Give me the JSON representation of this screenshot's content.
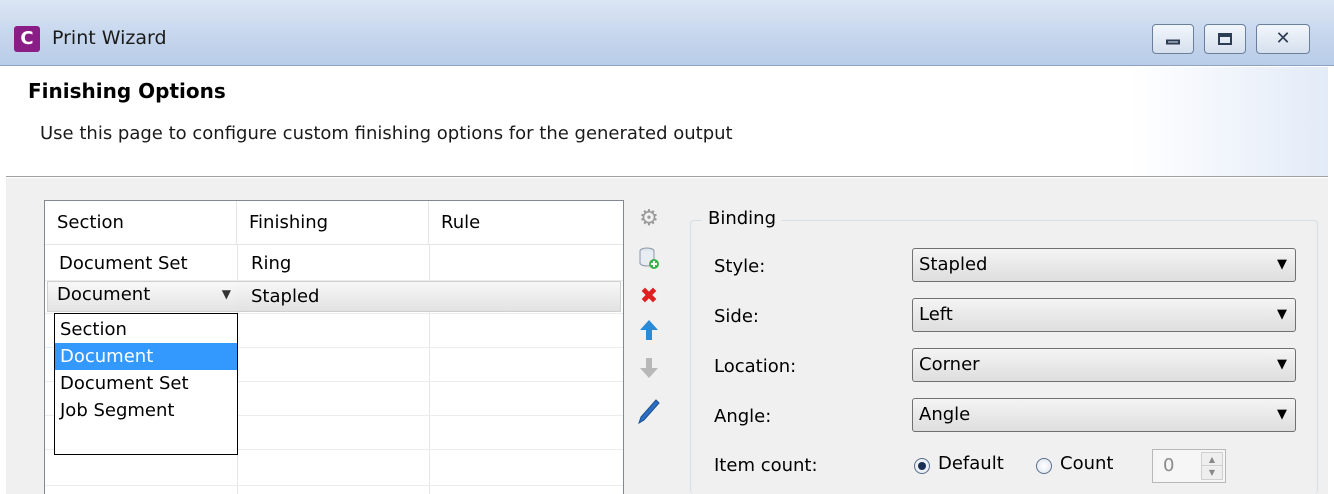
{
  "window": {
    "title": "Print Wizard",
    "icon_letter": "C"
  },
  "header": {
    "title": "Finishing Options",
    "description": "Use this page to configure custom finishing options for the generated output"
  },
  "table": {
    "columns": [
      "Section",
      "Finishing",
      "Rule"
    ],
    "rows": [
      {
        "section": "Document Set",
        "finishing": "Ring",
        "rule": ""
      },
      {
        "section": "Document",
        "finishing": "Stapled",
        "rule": ""
      }
    ],
    "dropdown_options": [
      "Section",
      "Document",
      "Document Set",
      "Job Segment"
    ],
    "dropdown_selected": "Document"
  },
  "toolbar": {
    "icons": [
      "gear-icon",
      "add-icon",
      "delete-icon",
      "move-up-icon",
      "move-down-icon",
      "edit-icon"
    ]
  },
  "binding": {
    "group_title": "Binding",
    "style_label": "Style:",
    "style_value": "Stapled",
    "side_label": "Side:",
    "side_value": "Left",
    "location_label": "Location:",
    "location_value": "Corner",
    "angle_label": "Angle:",
    "angle_value": "Angle",
    "item_count_label": "Item count:",
    "radio_default": "Default",
    "radio_count": "Count",
    "count_value": "0"
  },
  "colors": {
    "selection": "#3399ff",
    "delete_icon": "#e02020",
    "up_icon": "#2a8ad6",
    "app_icon": "#8a1e86"
  }
}
